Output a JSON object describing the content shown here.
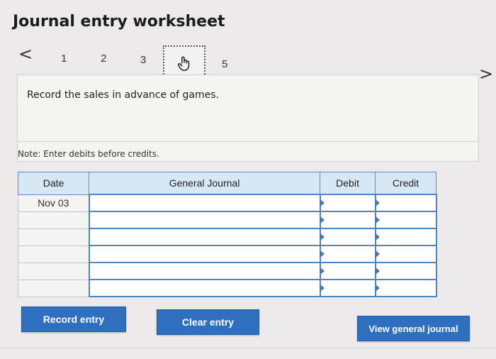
{
  "title": "Journal entry worksheet",
  "pager": {
    "prev_icon": "chevron-left-icon",
    "next_icon": "chevron-right-icon",
    "prev_glyph": "<",
    "next_glyph": ">",
    "steps": [
      "1",
      "2",
      "3",
      "4",
      "5"
    ],
    "current_step_icon": "hand-pointer-icon"
  },
  "instruction": "Record the sales in advance of games.",
  "note": "Note: Enter debits before credits.",
  "table": {
    "headers": {
      "date": "Date",
      "account": "General Journal",
      "debit": "Debit",
      "credit": "Credit"
    },
    "rows": [
      {
        "date": "Nov 03",
        "account": "",
        "debit": "",
        "credit": ""
      },
      {
        "date": "",
        "account": "",
        "debit": "",
        "credit": ""
      },
      {
        "date": "",
        "account": "",
        "debit": "",
        "credit": ""
      },
      {
        "date": "",
        "account": "",
        "debit": "",
        "credit": ""
      },
      {
        "date": "",
        "account": "",
        "debit": "",
        "credit": ""
      },
      {
        "date": "",
        "account": "",
        "debit": "",
        "credit": ""
      }
    ]
  },
  "buttons": {
    "record": "Record entry",
    "clear": "Clear entry",
    "view": "View general journal"
  },
  "colors": {
    "primary_button": "#2e6fbf",
    "table_border": "#5b8fc1",
    "header_fill": "#d7e7f4"
  }
}
